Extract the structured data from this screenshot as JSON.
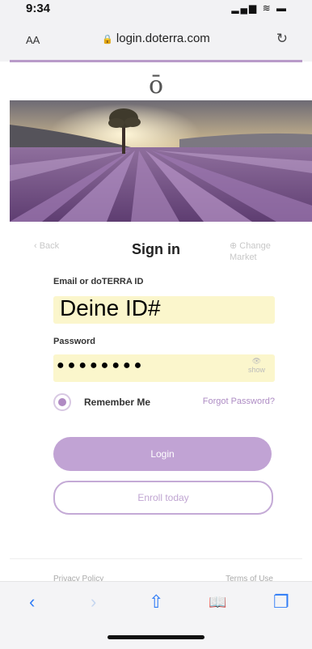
{
  "status": {
    "time": "9:34",
    "icons": "▂▄▆ ≋ ▬"
  },
  "browser": {
    "aa_label": "AA",
    "domain": "login.doterra.com",
    "lock_icon": "lock-icon",
    "reload_icon": "reload-icon"
  },
  "logo": "ō",
  "nav": {
    "back": "‹ Back",
    "title": "Sign in",
    "change_market": "⊕ Change Market"
  },
  "form": {
    "email_label": "Email or doTERRA ID",
    "email_value": "Deine ID#",
    "password_label": "Password",
    "password_value": "●●●●●●●●",
    "show_label": "show",
    "remember_label": "Remember Me",
    "forgot_label": "Forgot Password?",
    "login_label": "Login",
    "enroll_label": "Enroll today"
  },
  "footer": {
    "privacy": "Privacy Policy",
    "terms": "Terms of Use"
  },
  "toolbar": {
    "back": "‹",
    "forward": "›",
    "share": "⇧",
    "bookmarks": "📖",
    "tabs": "❐"
  },
  "colors": {
    "accent": "#c1a3d4",
    "input_bg": "#fbf6cc",
    "link": "#ae8cc4"
  }
}
